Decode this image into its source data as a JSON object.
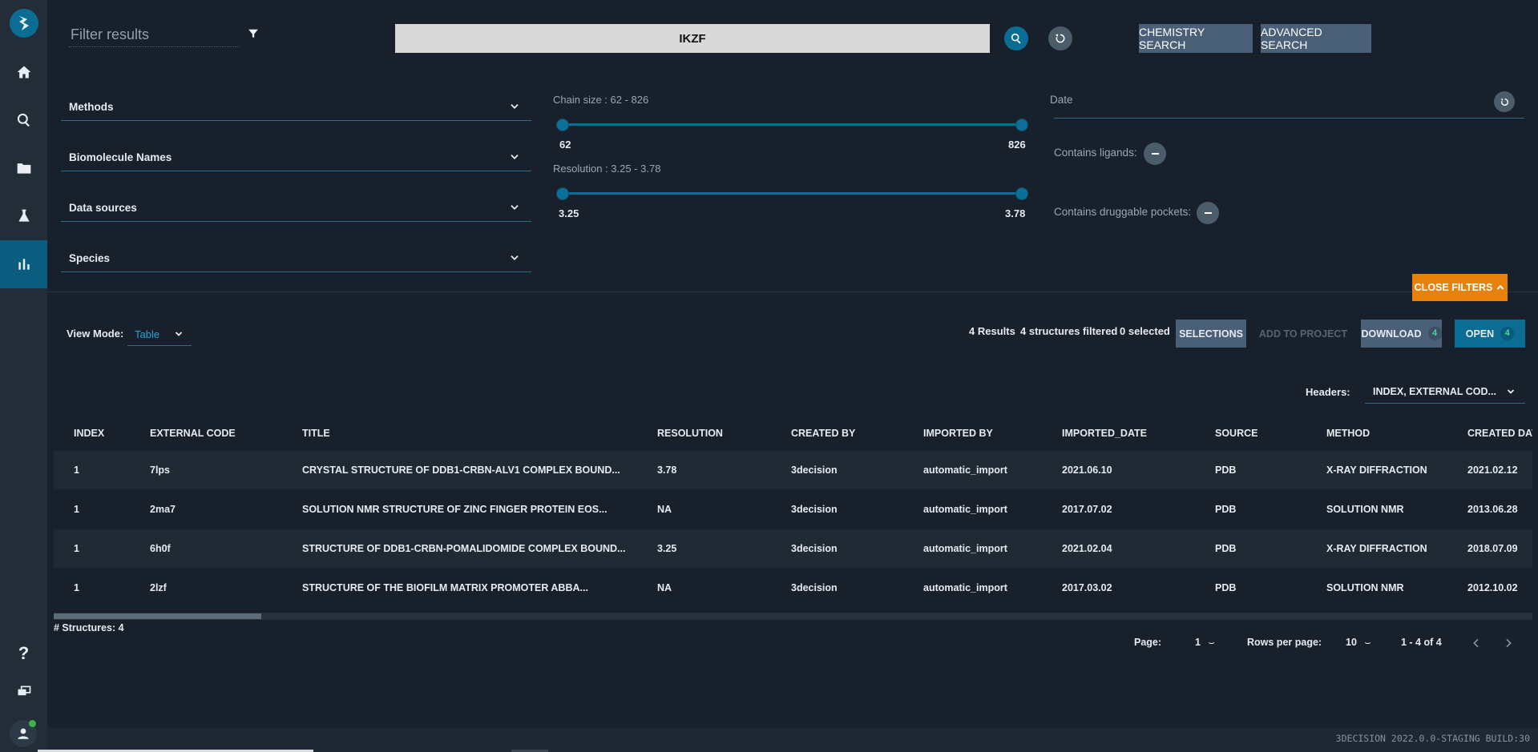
{
  "colors": {
    "background": "#18212b",
    "sidebar": "#222d38",
    "accent": "#0b5d80",
    "orange": "#e8800c",
    "slate_button": "#4a6079"
  },
  "sidebar": {
    "logo_icon": "3decision-logo",
    "items": [
      {
        "icon": "home-icon"
      },
      {
        "icon": "search-icon"
      },
      {
        "icon": "folder-icon"
      },
      {
        "icon": "flask-icon"
      },
      {
        "icon": "bar-chart-icon",
        "active": true
      }
    ],
    "bottom": [
      {
        "icon": "help-icon"
      },
      {
        "icon": "messages-icon"
      },
      {
        "icon": "user-icon"
      }
    ]
  },
  "topbar": {
    "filter_placeholder": "Filter results",
    "search_query": "IKZF",
    "chemistry_search_label": "CHEMISTRY SEARCH",
    "advanced_search_label": "ADVANCED SEARCH"
  },
  "filters": {
    "dropdowns": [
      "Methods",
      "Biomolecule Names",
      "Data sources",
      "Species"
    ],
    "chain_size": {
      "title": "Chain size : 62 - 826",
      "min_label": "62",
      "max_label": "826"
    },
    "resolution": {
      "title": "Resolution : 3.25 - 3.78",
      "min_label": "3.25",
      "max_label": "3.78"
    },
    "date_label": "Date",
    "contains_ligands_label": "Contains ligands:",
    "contains_pockets_label": "Contains druggable pockets:",
    "close_filters_label": "CLOSE FILTERS"
  },
  "results_bar": {
    "view_mode_label": "View Mode:",
    "view_mode_value": "Table",
    "results_count": "4 Results",
    "structures_filtered": "4 structures filtered",
    "selected": "0 selected",
    "selections_label": "SELECTIONS",
    "add_to_project_label": "ADD TO PROJECT",
    "download_label": "DOWNLOAD",
    "download_count": "4",
    "open_label": "OPEN",
    "open_count": "4",
    "headers_label": "Headers:",
    "headers_value": "INDEX, EXTERNAL COD..."
  },
  "table": {
    "columns": [
      "INDEX",
      "EXTERNAL CODE",
      "TITLE",
      "RESOLUTION",
      "CREATED BY",
      "IMPORTED BY",
      "IMPORTED_DATE",
      "SOURCE",
      "METHOD",
      "CREATED DAT"
    ],
    "rows": [
      [
        "1",
        "7lps",
        "CRYSTAL STRUCTURE OF DDB1-CRBN-ALV1 COMPLEX BOUND...",
        "3.78",
        "3decision",
        "automatic_import",
        "2021.06.10",
        "PDB",
        "X-RAY DIFFRACTION",
        "2021.02.12"
      ],
      [
        "1",
        "2ma7",
        "SOLUTION NMR STRUCTURE OF ZINC FINGER PROTEIN EOS...",
        "NA",
        "3decision",
        "automatic_import",
        "2017.07.02",
        "PDB",
        "SOLUTION NMR",
        "2013.06.28"
      ],
      [
        "1",
        "6h0f",
        "STRUCTURE OF DDB1-CRBN-POMALIDOMIDE COMPLEX BOUND...",
        "3.25",
        "3decision",
        "automatic_import",
        "2021.02.04",
        "PDB",
        "X-RAY DIFFRACTION",
        "2018.07.09"
      ],
      [
        "1",
        "2lzf",
        "STRUCTURE OF THE BIOFILM MATRIX PROMOTER ABBA...",
        "NA",
        "3decision",
        "automatic_import",
        "2017.03.02",
        "PDB",
        "SOLUTION NMR",
        "2012.10.02"
      ]
    ]
  },
  "footer": {
    "structures_count": "# Structures: 4",
    "page_label": "Page:",
    "page_value": "1",
    "rows_per_page_label": "Rows per page:",
    "rows_per_page_value": "10",
    "range": "1 - 4 of 4",
    "build": "3DECISION 2022.0.0-STAGING BUILD:30"
  }
}
